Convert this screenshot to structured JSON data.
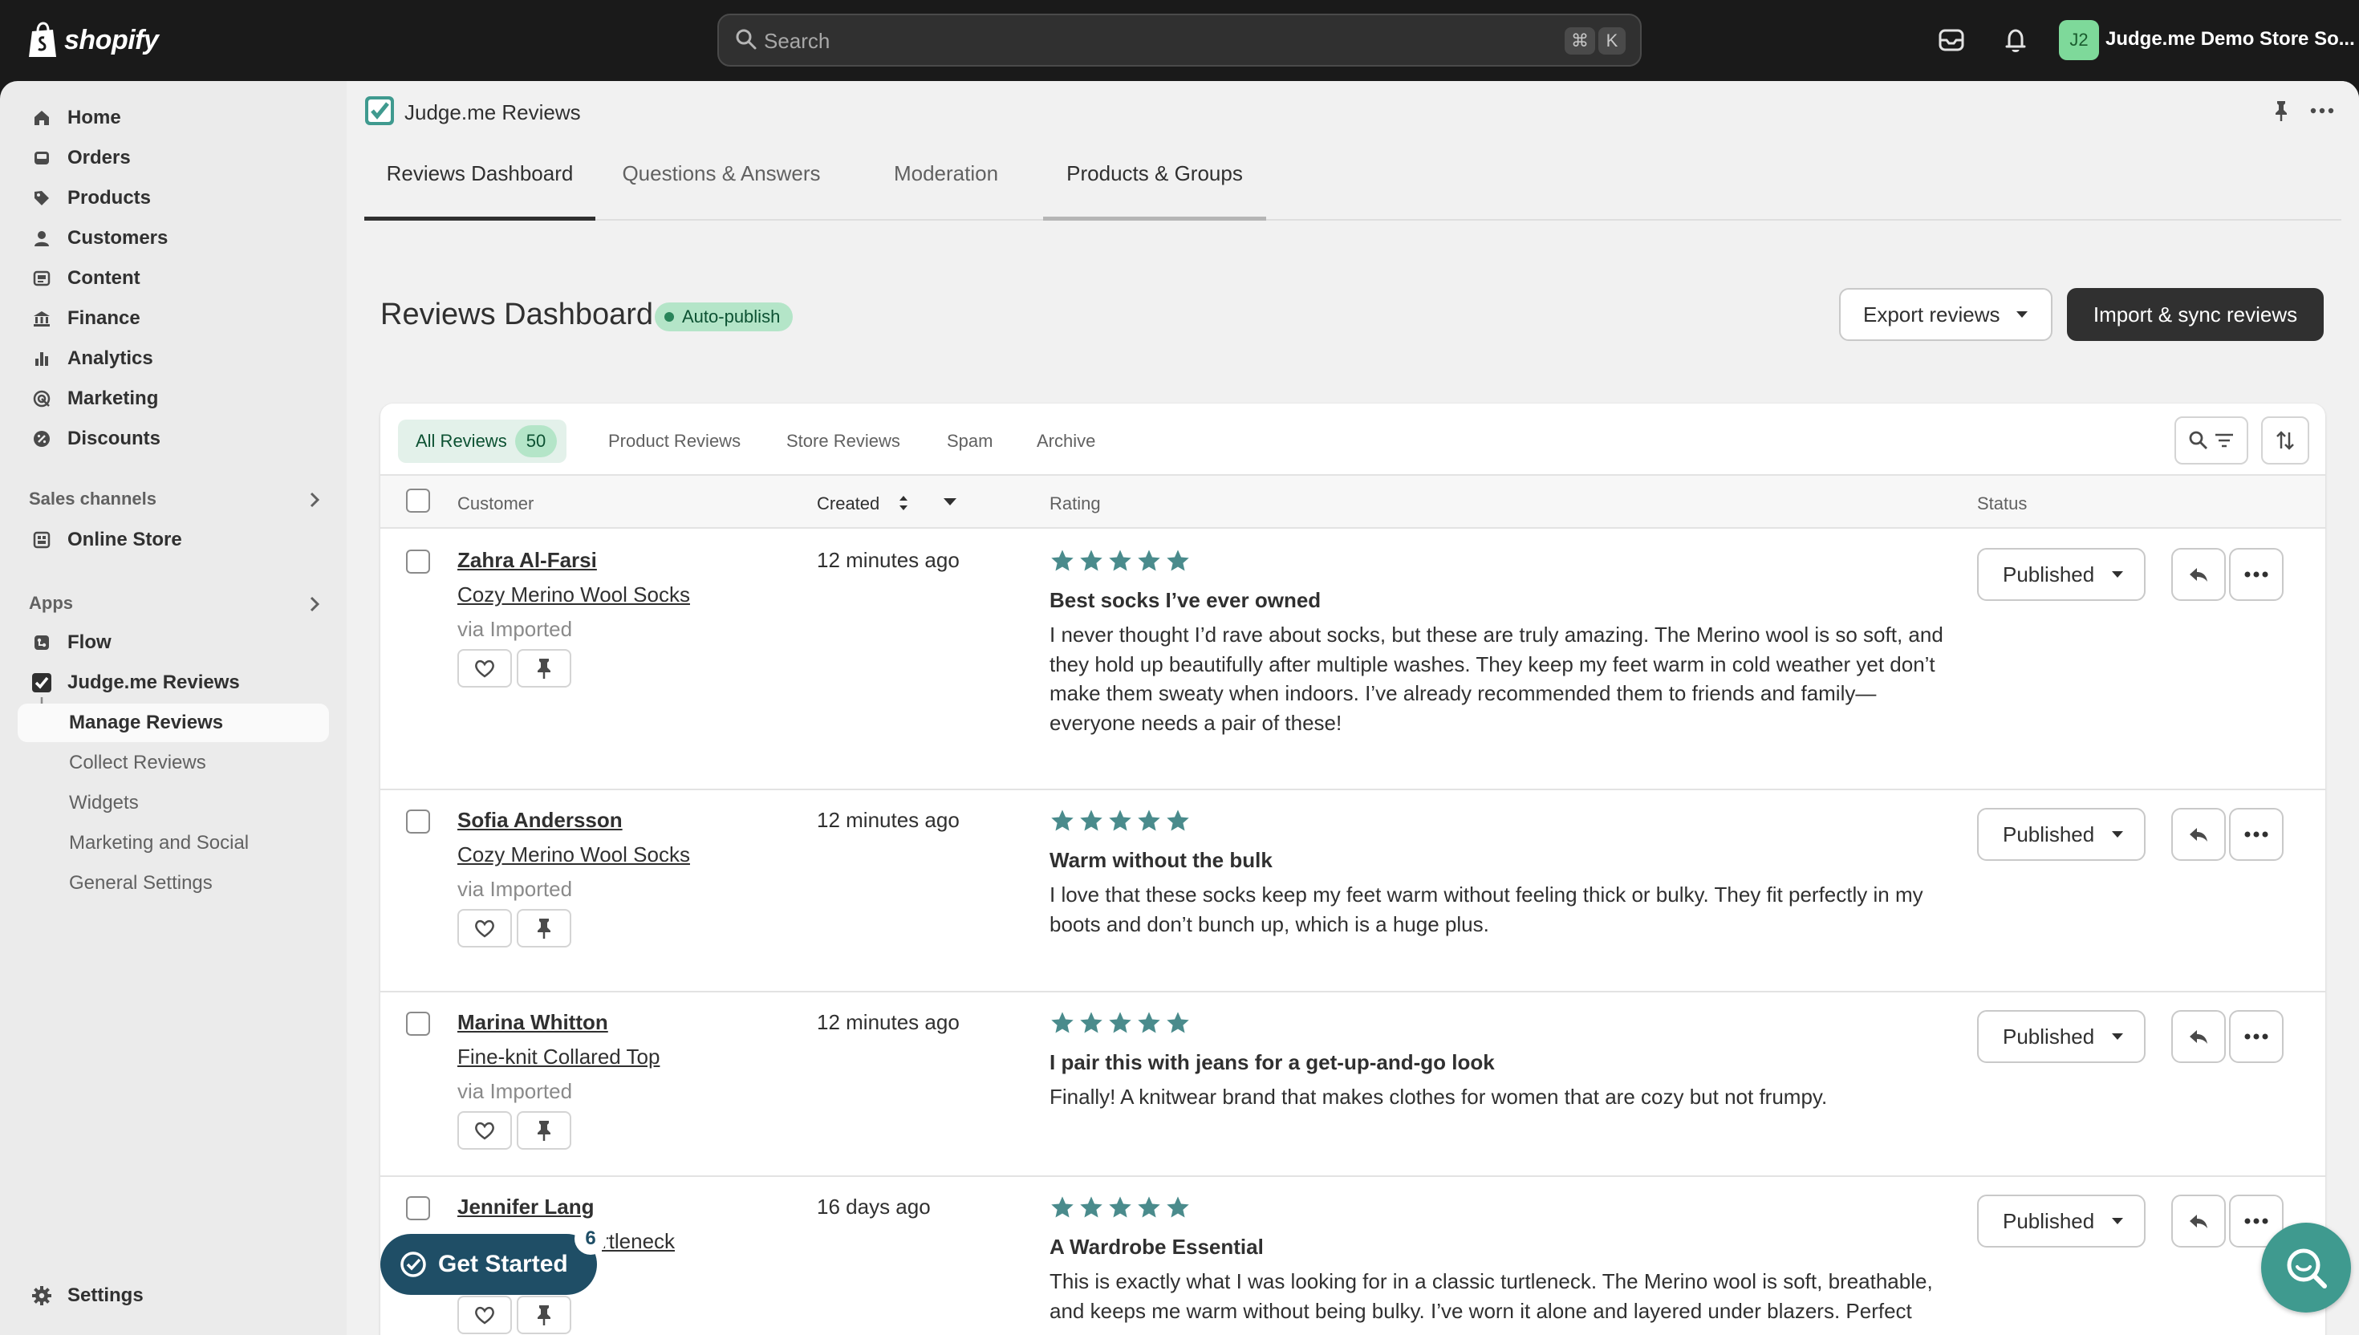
{
  "topbar": {
    "logo_text": "shopify",
    "search_placeholder": "Search",
    "shortcut_cmd": "⌘",
    "shortcut_key": "K",
    "store_badge": "J2",
    "store_name": "Judge.me Demo Store So..."
  },
  "sidebar": {
    "items": [
      {
        "label": "Home",
        "icon": "home-icon"
      },
      {
        "label": "Orders",
        "icon": "orders-icon"
      },
      {
        "label": "Products",
        "icon": "tag-icon"
      },
      {
        "label": "Customers",
        "icon": "person-icon"
      },
      {
        "label": "Content",
        "icon": "content-icon"
      },
      {
        "label": "Finance",
        "icon": "bank-icon"
      },
      {
        "label": "Analytics",
        "icon": "bar-chart-icon"
      },
      {
        "label": "Marketing",
        "icon": "target-icon"
      },
      {
        "label": "Discounts",
        "icon": "discount-icon"
      }
    ],
    "sales_channels_label": "Sales channels",
    "online_store_label": "Online Store",
    "apps_label": "Apps",
    "flow_label": "Flow",
    "judgeme_label": "Judge.me Reviews",
    "subitems": [
      "Manage Reviews",
      "Collect Reviews",
      "Widgets",
      "Marketing and Social",
      "General Settings"
    ],
    "settings_label": "Settings"
  },
  "app": {
    "title": "Judge.me Reviews",
    "tabs": [
      "Reviews Dashboard",
      "Questions & Answers",
      "Moderation",
      "Products & Groups"
    ],
    "active_tab": "Reviews Dashboard"
  },
  "page": {
    "title": "Reviews Dashboard",
    "badge": "Auto-publish",
    "export_label": "Export reviews",
    "import_label": "Import & sync reviews"
  },
  "filters": {
    "tabs": [
      "All Reviews",
      "Product Reviews",
      "Store Reviews",
      "Spam",
      "Archive"
    ],
    "all_count": "50"
  },
  "table": {
    "headers": {
      "customer": "Customer",
      "created": "Created",
      "rating": "Rating",
      "status": "Status"
    },
    "rows": [
      {
        "customer": "Zahra Al-Farsi",
        "product": "Cozy Merino Wool Socks",
        "source": "via Imported",
        "created": "12 minutes ago",
        "rating": 5,
        "title": "Best socks I’ve ever owned",
        "body": "I never thought I’d rave about socks, but these are truly amazing. The Merino wool is so soft, and they hold up beautifully after multiple washes. They keep my feet warm in cold weather yet don’t make them sweaty when indoors. I’ve already recommended them to friends and family—everyone needs a pair of these!",
        "status": "Published"
      },
      {
        "customer": "Sofia Andersson",
        "product": "Cozy Merino Wool Socks",
        "source": "via Imported",
        "created": "12 minutes ago",
        "rating": 5,
        "title": "Warm without the bulk",
        "body": "I love that these socks keep my feet warm without feeling thick or bulky. They fit perfectly in my boots and don’t bunch up, which is a huge plus.",
        "status": "Published"
      },
      {
        "customer": "Marina Whitton",
        "product": "Fine-knit Collared Top",
        "source": "via Imported",
        "created": "12 minutes ago",
        "rating": 5,
        "title": "I pair this with jeans for a get-up-and-go look",
        "body": "Finally! A knitwear brand that makes clothes for women that are cozy but not frumpy.",
        "status": "Published"
      },
      {
        "customer": "Jennifer Lang",
        "product": "rtleneck",
        "source": "",
        "created": "16 days ago",
        "rating": 5,
        "title": "A Wardrobe Essential",
        "body": "This is exactly what I was looking for in a classic turtleneck. The Merino wool is soft, breathable, and keeps me warm without being bulky. I’ve worn it alone and layered under blazers. Perfect",
        "status": "Published"
      }
    ]
  },
  "widgets": {
    "get_started_label": "Get Started",
    "get_started_count": "6"
  },
  "colors": {
    "star": "#4a8b8c",
    "accent_green": "#b4e5c8",
    "get_started_bg": "#1f4e66",
    "help_fab_bg": "#3f9a8f"
  }
}
